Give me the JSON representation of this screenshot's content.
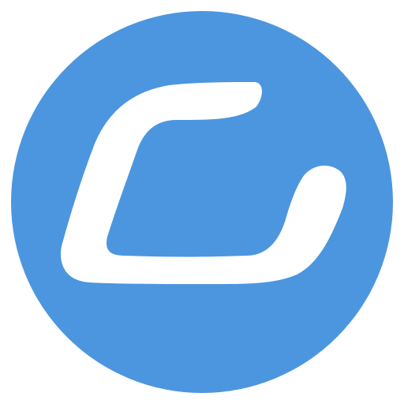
{
  "logo": {
    "icon": "c-letter-logo-icon",
    "circle_color": "#4C96DF",
    "glyph_color": "#FFFFFF",
    "background_color": "#FFFFFF"
  }
}
